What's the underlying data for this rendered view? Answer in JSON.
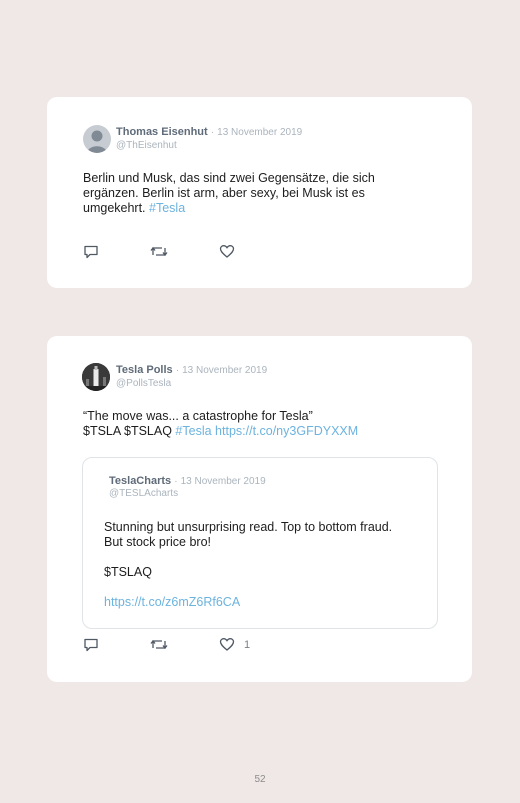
{
  "tweets": [
    {
      "author": {
        "name": "Thomas Eisenhut",
        "handle": "@ThEisenhut"
      },
      "date": "13 November 2019",
      "text_lines": [
        "Berlin und Musk, das sind zwei Gegensätze, die sich",
        "ergänzen. Berlin ist arm, aber sexy, bei Musk ist es",
        "umgekehrt."
      ],
      "hashtag": "#Tesla",
      "icons": [
        "reply-icon",
        "retweet-icon",
        "like-icon"
      ]
    },
    {
      "author": {
        "name": "Tesla Polls",
        "handle": "@PollsTesla"
      },
      "date": "13 November 2019",
      "text_line1": "“The move was... a catastrophe for Tesla”",
      "text_line2_prefix": "$TSLA $TSLAQ",
      "hashtag": "#Tesla",
      "link": "https://t.co/ny3GFDYXXM",
      "quoted": {
        "author": {
          "name": "TeslaCharts",
          "handle": "@TESLAcharts"
        },
        "date": "13 November 2019",
        "line1": "Stunning but unsurprising read. Top to bottom fraud.",
        "line2": "But stock price bro!",
        "line3": "$TSLAQ",
        "link": "https://t.co/z6mZ6Rf6CA"
      },
      "like_count": "1",
      "icons": [
        "reply-icon",
        "retweet-icon",
        "like-icon"
      ]
    }
  ],
  "separator": "·",
  "page_number": "52"
}
